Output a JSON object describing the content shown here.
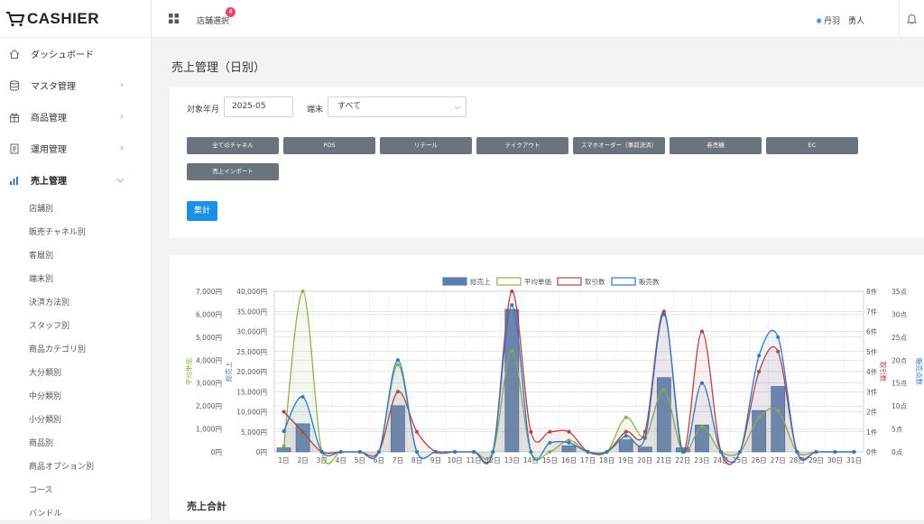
{
  "app": {
    "logo_text": "CASHIER"
  },
  "header": {
    "store_select": "店舗選択",
    "badge_count": "4",
    "user_name": "丹羽　勇人"
  },
  "sidebar": {
    "items": [
      {
        "label": "ダッシュボード",
        "icon": "home-icon"
      },
      {
        "label": "マスタ管理",
        "icon": "database-icon"
      },
      {
        "label": "商品管理",
        "icon": "gift-icon"
      },
      {
        "label": "運用管理",
        "icon": "document-icon"
      },
      {
        "label": "売上管理",
        "icon": "bar-chart-icon"
      }
    ],
    "subitems": [
      "店舗別",
      "販売チャネル別",
      "客層別",
      "端末別",
      "決済方法別",
      "スタッフ別",
      "商品カテゴリ別",
      "大分類別",
      "中分類別",
      "小分類別",
      "商品別",
      "商品オプション別",
      "コース",
      "バンドル"
    ]
  },
  "page": {
    "title": "売上管理（日別）"
  },
  "filters": {
    "month_label": "対象年月",
    "month_value": "2025-05",
    "terminal_label": "端末",
    "terminal_value": "すべて",
    "channels": [
      "全てのチャネル",
      "POS",
      "リテール",
      "テイクアウト",
      "スマホオーダー（事前決済）",
      "券売機",
      "EC",
      "売上インポート"
    ],
    "submit_label": "集計"
  },
  "summary": {
    "title": "売上合計"
  },
  "colors": {
    "bar": "#5b7fb0",
    "avg": "#8fb44a",
    "txn": "#b94040",
    "qty": "#2f78c4",
    "primary": "#1a8fe3",
    "channel_btn": "#6b747d"
  },
  "chart_data": {
    "type": "bar",
    "categories": [
      "1日",
      "2日",
      "3日",
      "4日",
      "5日",
      "6日",
      "7日",
      "8日",
      "9日",
      "10日",
      "11日",
      "12日",
      "13日",
      "14日",
      "15日",
      "16日",
      "17日",
      "18日",
      "19日",
      "20日",
      "21日",
      "22日",
      "23日",
      "24日",
      "25日",
      "26日",
      "27日",
      "28日",
      "29日",
      "30日",
      "31日"
    ],
    "series": [
      {
        "name": "総売上",
        "type": "bar",
        "axis": "y1",
        "values": [
          1000,
          7000,
          0,
          0,
          0,
          0,
          11500,
          0,
          0,
          0,
          0,
          0,
          35500,
          0,
          0,
          1500,
          0,
          0,
          3000,
          1200,
          18500,
          1000,
          6700,
          0,
          0,
          10300,
          16300,
          0,
          0,
          0,
          0
        ]
      },
      {
        "name": "平均単価",
        "type": "line",
        "axis": "y0",
        "values": [
          250,
          7000,
          0,
          0,
          0,
          0,
          3800,
          0,
          0,
          0,
          0,
          0,
          4400,
          0,
          0,
          500,
          0,
          0,
          1500,
          650,
          2700,
          0,
          1100,
          0,
          0,
          1500,
          1800,
          0,
          0,
          0,
          0
        ]
      },
      {
        "name": "取引数",
        "type": "line",
        "axis": "y2",
        "values": [
          2,
          1,
          0,
          0,
          0,
          0,
          3,
          1,
          0,
          0,
          0,
          0,
          8,
          1,
          1,
          1,
          0,
          0,
          1,
          1,
          7,
          0,
          6,
          0,
          0,
          4,
          5,
          0,
          0,
          0,
          0
        ]
      },
      {
        "name": "販売数",
        "type": "line",
        "axis": "y3",
        "values": [
          4.5,
          12,
          0,
          0,
          0,
          0,
          20,
          0,
          0,
          0,
          0,
          0,
          32,
          0,
          2,
          2,
          0,
          0,
          3.5,
          3,
          30,
          0,
          15,
          0,
          0,
          21,
          25,
          0,
          0,
          0,
          0
        ]
      }
    ],
    "axes": {
      "y0": {
        "label": "平均単価",
        "min": 0,
        "max": 7000,
        "ticks": [
          "0円",
          "1,000円",
          "2,000円",
          "3,000円",
          "4,000円",
          "5,000円",
          "6,000円",
          "7,000円"
        ]
      },
      "y1": {
        "label": "総売上",
        "min": 0,
        "max": 40000,
        "ticks": [
          "0円",
          "5,000円",
          "10,000円",
          "15,000円",
          "20,000円",
          "25,000円",
          "30,000円",
          "35,000円",
          "40,000円"
        ]
      },
      "y2": {
        "label": "取引数",
        "min": 0,
        "max": 8,
        "ticks": [
          "0件",
          "1件",
          "2件",
          "3件",
          "4件",
          "5件",
          "6件",
          "7件",
          "8件"
        ]
      },
      "y3": {
        "label": "販売点数",
        "min": 0,
        "max": 35,
        "ticks": [
          "0点",
          "5点",
          "10点",
          "15点",
          "20点",
          "25点",
          "30点",
          "35点"
        ]
      }
    },
    "legend_position": "top"
  }
}
